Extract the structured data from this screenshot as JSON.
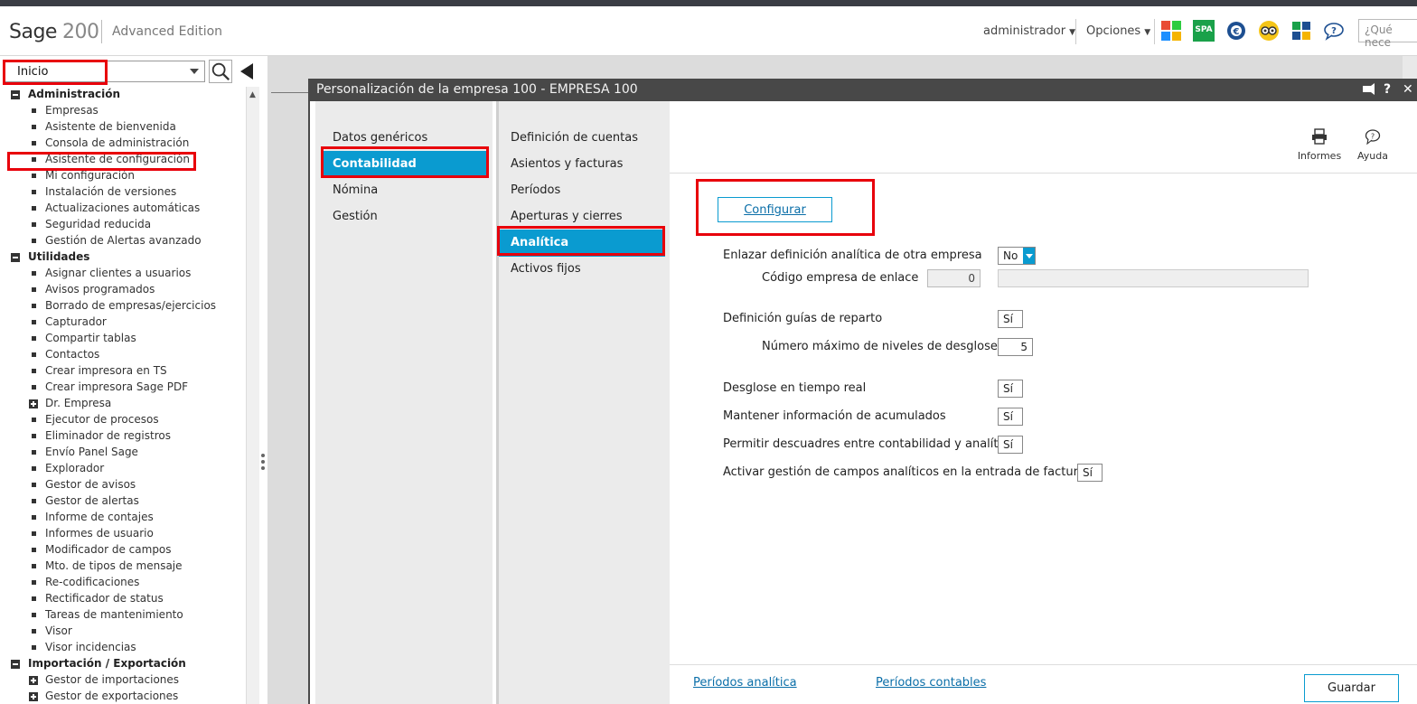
{
  "app": {
    "brand": "Sage",
    "brand_number": "200",
    "edition": "Advanced Edition",
    "user_menu": "administrador",
    "options_menu": "Opciones",
    "spa_badge": "SPA",
    "search_placeholder": "¿Qué nece",
    "header_icons": [
      "windows-grid-icon",
      "spa-icon",
      "euro-gear-icon",
      "glasses-icon",
      "puzzle-icon",
      "chat-help-icon"
    ]
  },
  "sidebar": {
    "module": "Inicio",
    "groups": [
      {
        "label": "Administración",
        "items": [
          "Empresas",
          "Asistente de bienvenida",
          "Consola de administración",
          "Asistente de configuración",
          "Mi configuración",
          "Instalación de versiones",
          "Actualizaciones automáticas",
          "Seguridad reducida",
          "Gestión de Alertas avanzado"
        ]
      },
      {
        "label": "Utilidades",
        "items": [
          "Asignar clientes a usuarios",
          "Avisos programados",
          "Borrado de empresas/ejercicios",
          "Capturador",
          "Compartir tablas",
          "Contactos",
          "Crear impresora en TS",
          "Crear impresora Sage PDF",
          "Dr. Empresa",
          "Ejecutor de procesos",
          "Eliminador de registros",
          "Envío Panel Sage",
          "Explorador",
          "Gestor de avisos",
          "Gestor de alertas",
          "Informe de contajes",
          "Informes de usuario",
          "Modificador de campos",
          "Mto. de tipos de mensaje",
          "Re-codificaciones",
          "Rectificador de status",
          "Tareas de mantenimiento",
          "Visor",
          "Visor incidencias"
        ]
      },
      {
        "label": "Importación / Exportación",
        "items": [
          "Gestor de importaciones",
          "Gestor de exportaciones"
        ]
      }
    ]
  },
  "window": {
    "title": "Personalización de la empresa  100 - EMPRESA 100",
    "controls": [
      "pin-icon",
      "?",
      "✕"
    ],
    "categories": [
      "Datos genéricos",
      "Contabilidad",
      "Nómina",
      "Gestión"
    ],
    "selected_category": "Contabilidad",
    "subsections": [
      "Definición de cuentas",
      "Asientos y facturas",
      "Períodos",
      "Aperturas y cierres",
      "Analítica",
      "Activos fijos"
    ],
    "selected_subsection": "Analítica",
    "toolbar": {
      "informes": "Informes",
      "ayuda": "Ayuda"
    },
    "configure_button": "Configurar",
    "fields": {
      "link_analytics_label": "Enlazar definición analítica de otra empresa",
      "link_analytics_value": "No",
      "link_company_label": "Código empresa de enlace",
      "link_company_value": "0",
      "guides_label": "Definición guías de reparto",
      "guides_value": "Sí",
      "max_levels_label": "Número máximo de niveles de desglose",
      "max_levels_value": "5",
      "realtime_label": "Desglose en tiempo real",
      "realtime_value": "Sí",
      "accum_label": "Mantener información de acumulados",
      "accum_value": "Sí",
      "mismatch_label": "Permitir descuadres entre contabilidad y analítica",
      "mismatch_value": "Sí",
      "invoice_fields_label": "Activar gestión de campos analíticos en la entrada de facturas",
      "invoice_fields_value": "Sí"
    },
    "footer": {
      "link_analytic_periods": "Períodos analítica",
      "link_accounting_periods": "Períodos contables",
      "save_button": "Guardar"
    }
  },
  "colors": {
    "accent": "#0a9bd0",
    "highlight_border": "#e8000b",
    "title_bar": "#484848"
  }
}
